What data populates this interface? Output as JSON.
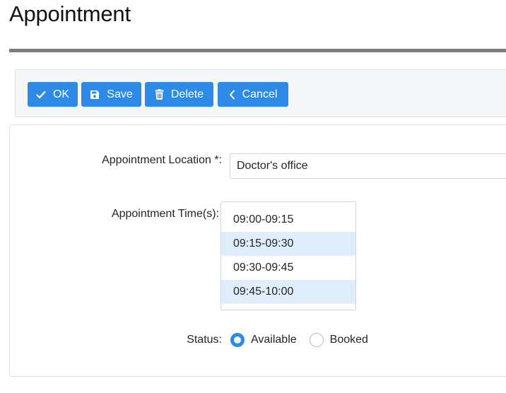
{
  "page": {
    "title": "Appointment"
  },
  "toolbar": {
    "ok_label": "OK",
    "save_label": "Save",
    "delete_label": "Delete",
    "cancel_label": "Cancel"
  },
  "form": {
    "location": {
      "label": "Appointment Location *:",
      "value": "Doctor's office"
    },
    "times": {
      "label": "Appointment Time(s):",
      "options": [
        {
          "label": "09:00-09:15",
          "selected": false
        },
        {
          "label": "09:15-09:30",
          "selected": true
        },
        {
          "label": "09:30-09:45",
          "selected": false
        },
        {
          "label": "09:45-10:00",
          "selected": true
        }
      ]
    },
    "status": {
      "label": "Status:",
      "options": [
        {
          "label": "Available",
          "checked": true
        },
        {
          "label": "Booked",
          "checked": false
        }
      ]
    }
  },
  "colors": {
    "primary": "#2d8ae6",
    "selected_row": "#e0eefb",
    "rule": "#7b7e81"
  },
  "icons": {
    "ok": "check-icon",
    "save": "floppy-disk-icon",
    "delete": "trash-icon",
    "cancel": "chevron-left-icon"
  }
}
